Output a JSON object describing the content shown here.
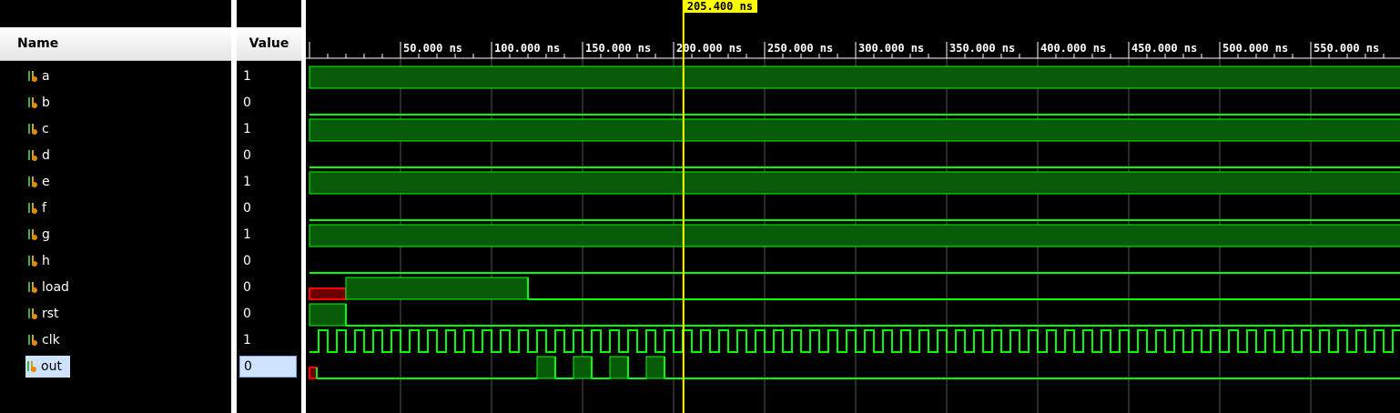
{
  "name_header": "Name",
  "value_header": "Value",
  "cursor": {
    "time_ns": 205.4,
    "label": "205.400 ns"
  },
  "timeline": {
    "start_ns": 0,
    "visible_end_ns": 600,
    "major_ticks": [
      {
        "ns": 50,
        "label": "50.000 ns"
      },
      {
        "ns": 100,
        "label": "100.000 ns"
      },
      {
        "ns": 150,
        "label": "150.000 ns"
      },
      {
        "ns": 200,
        "label": "200.000 ns"
      },
      {
        "ns": 250,
        "label": "250.000 ns"
      },
      {
        "ns": 300,
        "label": "300.000 ns"
      },
      {
        "ns": 350,
        "label": "350.000 ns"
      },
      {
        "ns": 400,
        "label": "400.000 ns"
      },
      {
        "ns": 450,
        "label": "450.000 ns"
      },
      {
        "ns": 500,
        "label": "500.000 ns"
      },
      {
        "ns": 550,
        "label": "550.000 ns"
      }
    ]
  },
  "colors": {
    "wave_high": "#00ff00",
    "wave_fill": "#075a07",
    "unknown": "#ff0000",
    "unknown_fill": "#6b0000",
    "cursor": "#ffff00",
    "grid": "#555555",
    "selection": "#cfe3ff"
  },
  "signals": [
    {
      "name": "a",
      "value": "1",
      "kind": "bit",
      "segments": [
        {
          "t0": 0,
          "t1": 600,
          "v": "1"
        }
      ]
    },
    {
      "name": "b",
      "value": "0",
      "kind": "bit",
      "segments": [
        {
          "t0": 0,
          "t1": 600,
          "v": "0"
        }
      ]
    },
    {
      "name": "c",
      "value": "1",
      "kind": "bit",
      "segments": [
        {
          "t0": 0,
          "t1": 600,
          "v": "1"
        }
      ]
    },
    {
      "name": "d",
      "value": "0",
      "kind": "bit",
      "segments": [
        {
          "t0": 0,
          "t1": 600,
          "v": "0"
        }
      ]
    },
    {
      "name": "e",
      "value": "1",
      "kind": "bit",
      "segments": [
        {
          "t0": 0,
          "t1": 600,
          "v": "1"
        }
      ]
    },
    {
      "name": "f",
      "value": "0",
      "kind": "bit",
      "segments": [
        {
          "t0": 0,
          "t1": 600,
          "v": "0"
        }
      ]
    },
    {
      "name": "g",
      "value": "1",
      "kind": "bit",
      "segments": [
        {
          "t0": 0,
          "t1": 600,
          "v": "1"
        }
      ]
    },
    {
      "name": "h",
      "value": "0",
      "kind": "bit",
      "segments": [
        {
          "t0": 0,
          "t1": 600,
          "v": "0"
        }
      ]
    },
    {
      "name": "load",
      "value": "0",
      "kind": "bit",
      "segments": [
        {
          "t0": 0,
          "t1": 20,
          "v": "X"
        },
        {
          "t0": 20,
          "t1": 120,
          "v": "1"
        },
        {
          "t0": 120,
          "t1": 600,
          "v": "0"
        }
      ]
    },
    {
      "name": "rst",
      "value": "0",
      "kind": "bit",
      "segments": [
        {
          "t0": 0,
          "t1": 20,
          "v": "1"
        },
        {
          "t0": 20,
          "t1": 600,
          "v": "0"
        }
      ]
    },
    {
      "name": "clk",
      "value": "1",
      "kind": "clock",
      "period_ns": 10,
      "first_rise_ns": 5
    },
    {
      "name": "out",
      "value": "0",
      "kind": "bit",
      "selected": true,
      "segments": [
        {
          "t0": 0,
          "t1": 4,
          "v": "X"
        },
        {
          "t0": 4,
          "t1": 125,
          "v": "0"
        },
        {
          "t0": 125,
          "t1": 135,
          "v": "1"
        },
        {
          "t0": 135,
          "t1": 145,
          "v": "0"
        },
        {
          "t0": 145,
          "t1": 155,
          "v": "1"
        },
        {
          "t0": 155,
          "t1": 165,
          "v": "0"
        },
        {
          "t0": 165,
          "t1": 175,
          "v": "1"
        },
        {
          "t0": 175,
          "t1": 185,
          "v": "0"
        },
        {
          "t0": 185,
          "t1": 195,
          "v": "1"
        },
        {
          "t0": 195,
          "t1": 600,
          "v": "0"
        }
      ]
    }
  ]
}
